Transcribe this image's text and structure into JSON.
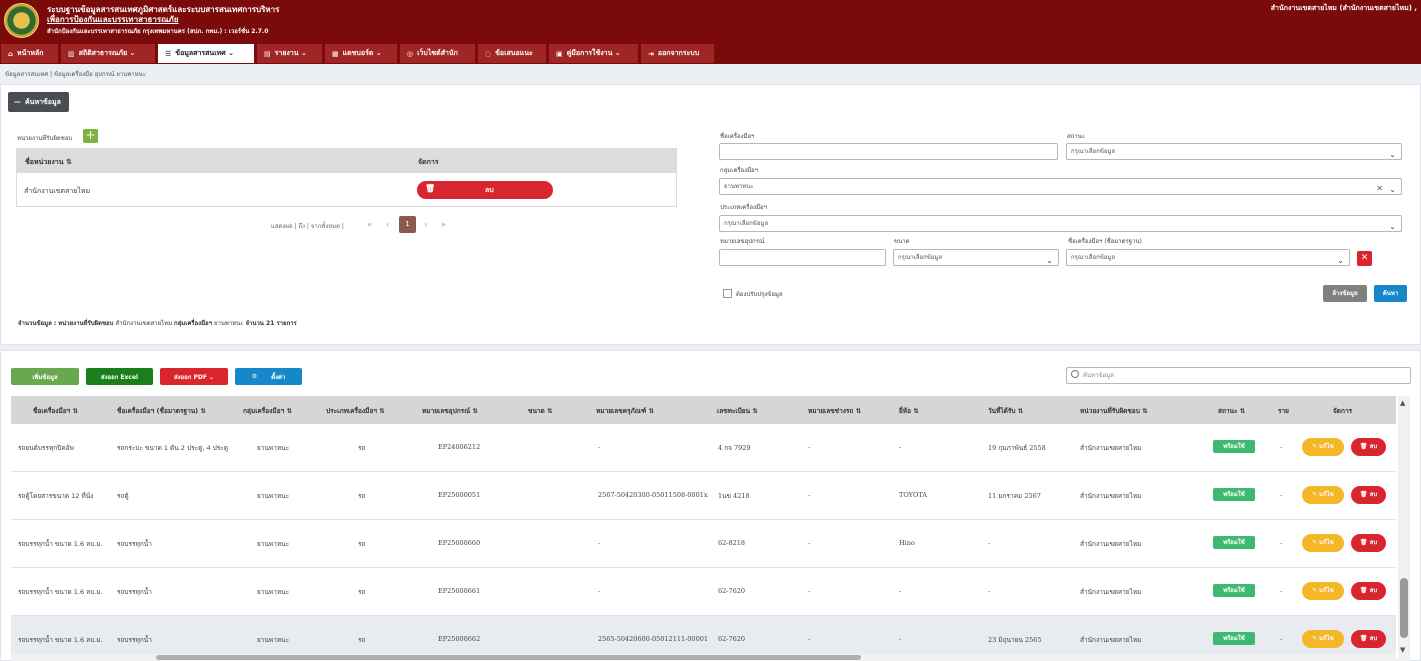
{
  "header": {
    "title_line1": "ระบบฐานข้อมูลสารสนเทศภูมิศาสตร์และระบบสารสนเทศการบริหาร",
    "title_line2": "เพื่อการป้องกันและบรรเทาสาธารณภัย",
    "title_line3": "สำนักป้องกันและบรรเทาสาธารณภัย กรุงเทพมหานคร (สปภ. กทม.) : เวอร์ชั่น 2.7.0",
    "user": "สำนักงานเขตสายไหม (สำนักงานเขตสายไหม) ,"
  },
  "nav": [
    {
      "label": "หน้าหลัก",
      "icon": "⌂"
    },
    {
      "label": "สถิติสาธารณภัย ⌄",
      "icon": "▥"
    },
    {
      "label": "ข้อมูลสารสนเทศ ⌄",
      "icon": "☰"
    },
    {
      "label": "รายงาน ⌄",
      "icon": "▤"
    },
    {
      "label": "แดชบอร์ด ⌄",
      "icon": "▦"
    },
    {
      "label": "เว็บไซต์สำนัก",
      "icon": "◎"
    },
    {
      "label": "ข้อเสนอแนะ",
      "icon": "◌"
    },
    {
      "label": "คู่มือการใช้งาน ⌄",
      "icon": "▣"
    },
    {
      "label": "ออกจากระบบ",
      "icon": "⇥"
    }
  ],
  "breadcrumb": "ข้อมูลสารสนเทศ | ข้อมูลเครื่องมือ อุปกรณ์ ยานพาหนะ",
  "search": {
    "toggle_label": "ค้นหาข้อมูล",
    "unit_label": "หน่วยงานที่รับผิดชอบ",
    "unit_table": {
      "col_name": "ชื่อหน่วยงาน ⇅",
      "col_action": "จัดการ",
      "row_name": "สำนักงานเขตสายไหม",
      "delete_label": "ลบ"
    },
    "pager_text": "แสดงผล | ถึง | จากทั้งหมด |",
    "pager_first": "«",
    "pager_prev": "‹",
    "pager_current": "1",
    "pager_next": "›",
    "pager_last": "»",
    "tool_name_label": "ชื่อเครื่องมือฯ",
    "tool_name_value": "",
    "status_label": "สถานะ",
    "status_value": "กรุณาเลือกข้อมูล",
    "group_label": "กลุ่มเครื่องมือฯ",
    "group_value": "ยานพาหนะ",
    "type_label": "ประเภทเครื่องมือฯ",
    "type_value": "กรุณาเลือกข้อมูล",
    "equip_no_label": "หมายเลขอุปกรณ์",
    "equip_no_value": "",
    "size_label": "ขนาด",
    "size_value": "กรุณาเลือกข้อมูล",
    "std_name_label": "ชื่อเครื่องมือฯ (ชื่อมาตรฐาน)",
    "std_name_value": "กรุณาเลือกข้อมูล",
    "checkbox_label": "ต้องปรับปรุงข้อมูล",
    "clear_label": "ล้างข้อมูล",
    "search_label": "ค้นหา",
    "summary_prefix": "จำนวนข้อมูล :",
    "summary_unit_label": "หน่วยงานที่รับผิดชอบ",
    "summary_unit_value": "สำนักงานเขตสายไหม",
    "summary_group_label": "กลุ่มเครื่องมือฯ",
    "summary_group_value": "ยานพาหนะ",
    "summary_count": "จำนวน 21 รายการ"
  },
  "actions": {
    "add": "เพิ่มข้อมูล",
    "excel": "ส่งออก Excel",
    "pdf": "ส่งออก PDF ⌄",
    "settings": "ตั้งค่า",
    "search_placeholder": "ค้นหาข้อมูล"
  },
  "table": {
    "headers": [
      "ชื่อเครื่องมือฯ ⇅",
      "ชื่อเครื่องมือฯ (ชื่อมาตรฐาน) ⇅",
      "กลุ่มเครื่องมือฯ ⇅",
      "ประเภทเครื่องมือฯ ⇅",
      "หมายเลขอุปกรณ์ ⇅",
      "ขนาด ⇅",
      "หมายเลขครุภัณฑ์ ⇅",
      "เลขทะเบียน ⇅",
      "หมายเลขช่างรถ ⇅",
      "ยี่ห้อ ⇅",
      "วันที่ได้รับ ⇅",
      "หน่วยงานที่รับผิดชอบ ⇅",
      "สถานะ ⇅",
      "ราย",
      "จัดการ"
    ],
    "edit_label": "แก้ไข",
    "delete_label": "ลบ",
    "rows": [
      [
        "รถยนต์บรรทุกปิคอัพ",
        "รถกระบะ ขนาด 1 ตัน 2 ประตู, 4 ประตู",
        "ยานพาหนะ",
        "รถ",
        "EP24006212",
        "",
        "-",
        "4 กจ 7929",
        "-",
        "-",
        "19 กุมภาพันธ์ 2558",
        "สำนักงานเขตสายไหม",
        "พร้อมใช้",
        "-"
      ],
      [
        "รถตู้โดยสารขนาด 12 ที่นั่ง",
        "รถตู้",
        "ยานพาหนะ",
        "รถ",
        "EP25000051",
        "",
        "2567-50420300-05011508-0001x",
        "1นข 4218",
        "-",
        "TOYOTA",
        "11 มกราคม 2567",
        "สำนักงานเขตสายไหม",
        "พร้อมใช้",
        "-"
      ],
      [
        "รถบรรทุกน้ำ ขนาด 1.6 ลบ.ม.",
        "รถบรรทุกน้ำ",
        "ยานพาหนะ",
        "รถ",
        "EP25000660",
        "",
        "-",
        "62-8218",
        "-",
        "Hino",
        "-",
        "สำนักงานเขตสายไหม",
        "พร้อมใช้",
        "-"
      ],
      [
        "รถบรรทุกน้ำ ขนาด 1.6 ลบ.ม.",
        "รถบรรทุกน้ำ",
        "ยานพาหนะ",
        "รถ",
        "EP25000661",
        "",
        "-",
        "62-7620",
        "-",
        "-",
        "-",
        "สำนักงานเขตสายไหม",
        "พร้อมใช้",
        "-"
      ],
      [
        "รถบรรทุกน้ำ ขนาด 1.6 ลบ.ม.",
        "รถบรรทุกน้ำ",
        "ยานพาหนะ",
        "รถ",
        "EP25000662",
        "",
        "2565-50420600-05012111-00001",
        "62-7620",
        "-",
        "-",
        "23 มิถุนายน 2565",
        "สำนักงานเขตสายไหม",
        "พร้อมใช้",
        "-"
      ]
    ]
  },
  "colors": {
    "brand": "#7b0a0a",
    "nav_item": "#a02626",
    "danger": "#d9262e",
    "success": "#3cbb70",
    "warning": "#f4b728",
    "primary": "#1687c9",
    "excel": "#1a7f1a",
    "settings": "#1687c9",
    "add": "#6aa84f"
  }
}
